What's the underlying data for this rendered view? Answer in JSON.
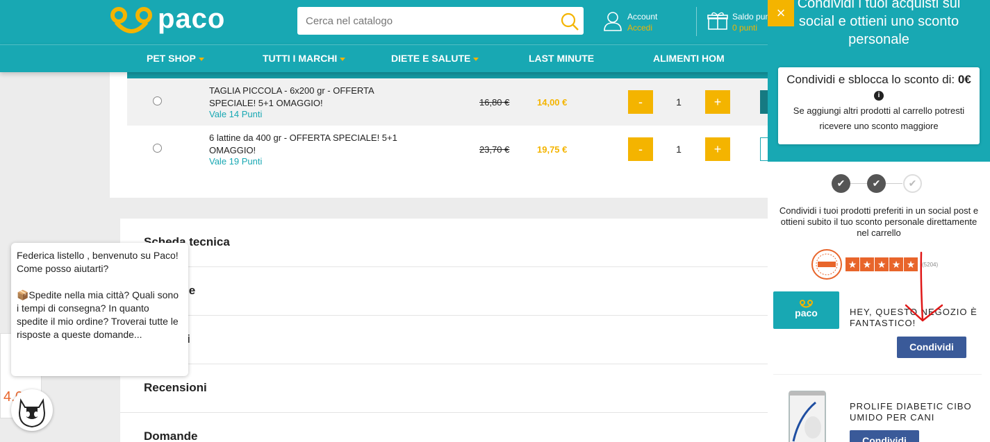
{
  "header": {
    "brand": "paco",
    "search_placeholder": "Cerca nel catalogo",
    "account_label": "Account",
    "account_action": "Accedi",
    "saldo_label": "Saldo pun",
    "saldo_value": "0 punti"
  },
  "nav": {
    "items": [
      {
        "label": "PET SHOP",
        "dropdown": true
      },
      {
        "label": "TUTTI I MARCHI",
        "dropdown": true
      },
      {
        "label": "DIETE E SALUTE",
        "dropdown": true
      },
      {
        "label": "LAST MINUTE",
        "dropdown": false
      },
      {
        "label": "ALIMENTI HOM",
        "dropdown": false
      }
    ]
  },
  "variants": [
    {
      "name": "TAGLIA PICCOLA - 6x200 gr - OFFERTA SPECIALE! 5+1 OMAGGIO!",
      "points": "Vale 14 Punti",
      "old_price": "16,80 €",
      "price": "14,00 €",
      "qty": "1",
      "minus": "-",
      "plus": "+"
    },
    {
      "name": "6 lattine da 400 gr - OFFERTA SPECIALE! 5+1 OMAGGIO!",
      "points": "Vale 19 Punti",
      "old_price": "23,70 €",
      "price": "19,75 €",
      "qty": "1",
      "minus": "-",
      "plus": "+"
    }
  ],
  "sections": [
    "Scheda tecnica",
    "one",
    "nti",
    "Recensioni",
    "Domande"
  ],
  "chat": {
    "greeting_1": "Federica listello , benvenuto su Paco!",
    "greeting_2": "Come posso aiutarti?",
    "message": "📦Spedite nella mia città? Quali sono i tempi di consegna? In quanto spedite il mio ordine? Troverai tutte le risposte a queste domande...",
    "rating_partial": "4,6"
  },
  "share_panel": {
    "close": "×",
    "headline": "Condividi i tuoi acquisti sui social e ottieni uno sconto personale",
    "discount_prefix": "Condividi e sblocca lo sconto di:",
    "discount_value": "0€",
    "info": "i",
    "note": "Se aggiungi altri prodotti al carrello potresti ricevere uno sconto maggiore",
    "steps": [
      "✔",
      "✔",
      "✔"
    ],
    "description": "Condividi i tuoi prodotti preferiti in un social post e ottieni subito il tuo sconto personale direttamente nel carrello",
    "review_count": "(5204)",
    "items": [
      {
        "title": "HEY, QUESTO NEGOZIO È FANTASTICO!",
        "button": "Condividi",
        "thumb_text": "paco"
      },
      {
        "title": "PROLIFE DIABETIC CIBO UMIDO PER CANI",
        "button": "Condividi"
      }
    ]
  },
  "colors": {
    "brand_teal": "#18a8b3",
    "accent_yellow": "#f4b400",
    "share_blue": "#3a5a99",
    "feedaty_orange": "#e8652b",
    "annotation_red": "#e01818"
  }
}
